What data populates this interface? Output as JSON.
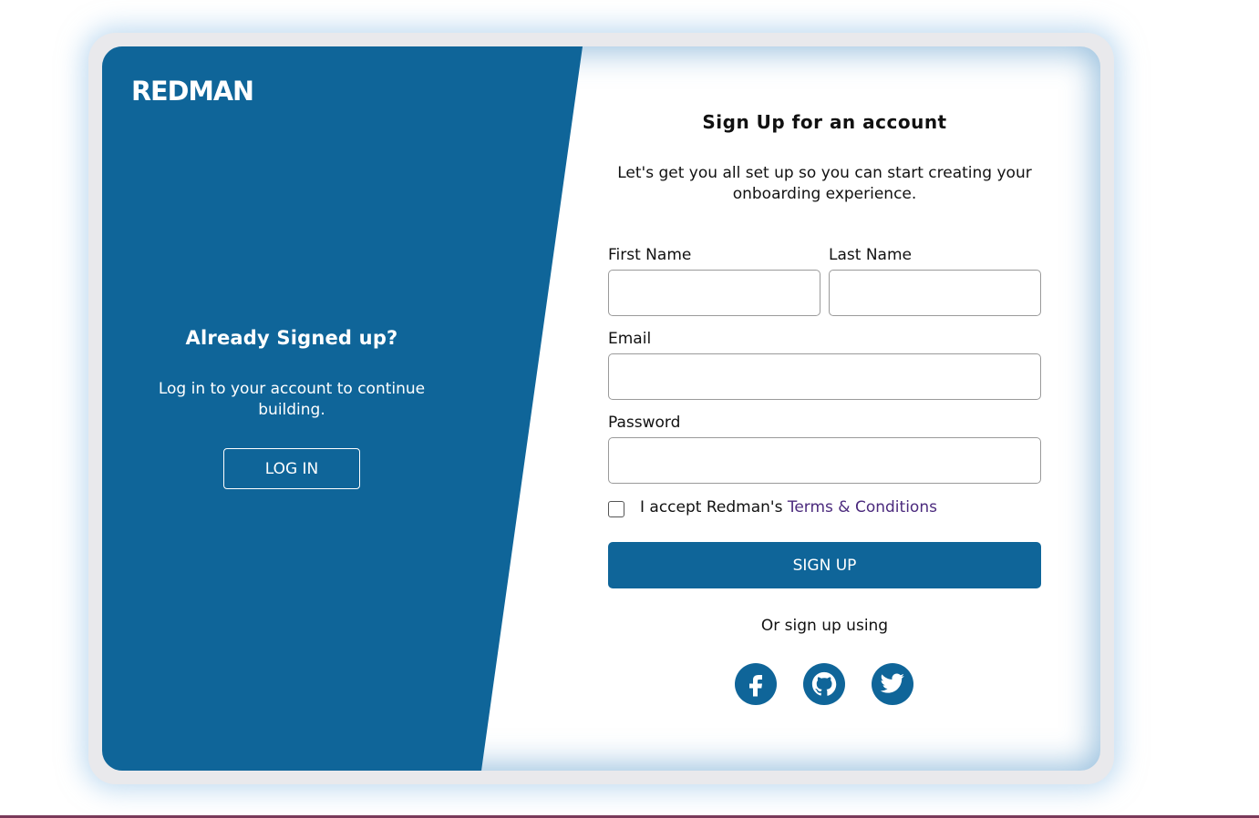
{
  "brand": {
    "logo_text": "REDMAN"
  },
  "left": {
    "title": "Already Signed up?",
    "subtitle": "Log in to your account to continue building.",
    "login_label": "LOG IN"
  },
  "form": {
    "title": "Sign Up for an account",
    "subtitle": "Let's get you all set up so you can start creating your onboarding experience.",
    "first_name_label": "First Name",
    "first_name_value": "",
    "last_name_label": "Last Name",
    "last_name_value": "",
    "email_label": "Email",
    "email_value": "",
    "password_label": "Password",
    "password_value": "",
    "terms_prefix": "I accept Redman's ",
    "terms_link": "Terms & Conditions",
    "terms_checked": false,
    "signup_label": "SIGN UP",
    "or_text": "Or sign up using"
  },
  "social": [
    {
      "name": "facebook",
      "icon": "facebook-icon"
    },
    {
      "name": "github",
      "icon": "github-icon"
    },
    {
      "name": "twitter",
      "icon": "twitter-icon"
    }
  ],
  "colors": {
    "primary": "#0f6599",
    "link": "#4b2a7d",
    "frame": "#e9e9ec"
  }
}
